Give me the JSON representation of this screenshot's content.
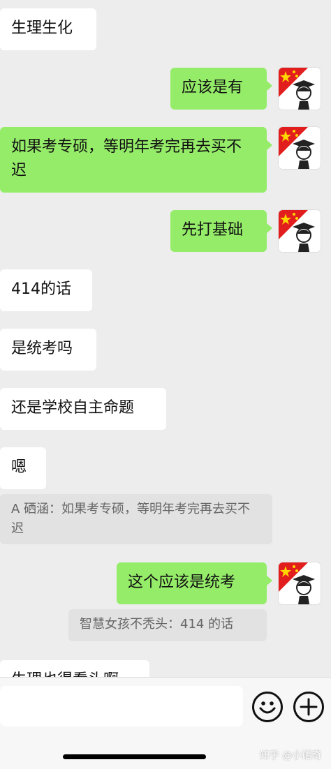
{
  "messages": {
    "m1": "生理生化",
    "m2": "应该是有",
    "m3": "如果考专硕，等明年考完再去买不迟",
    "m4": "先打基础",
    "m5": "414的话",
    "m6": "是统考吗",
    "m7": "还是学校自主命题",
    "m8": "嗯",
    "q1": "A 硒涵：如果考专硕，等明年考完再去买不迟",
    "m9": "这个应该是统考",
    "q2": "智慧女孩不秃头：414 的话",
    "m10": "生理也得看头啊"
  },
  "icons": {
    "emoji": "smiley-icon",
    "more": "plus-icon"
  },
  "watermark": "知乎 @小硒奇",
  "colors": {
    "background": "#ededed",
    "sent_bubble": "#95ec69",
    "received_bubble": "#ffffff"
  }
}
